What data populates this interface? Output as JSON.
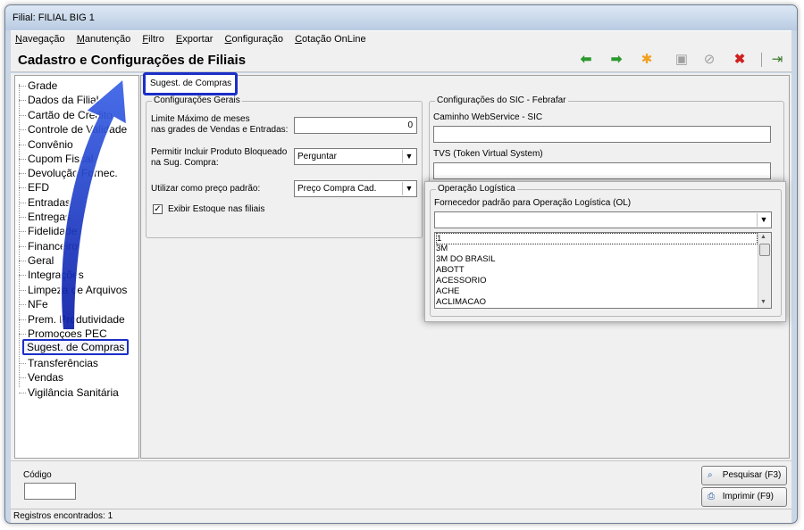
{
  "window": {
    "title": "Filial: FILIAL BIG 1"
  },
  "menu": [
    "Navegação",
    "Manutenção",
    "Filtro",
    "Exportar",
    "Configuração",
    "Cotação OnLine"
  ],
  "page_title": "Cadastro e Configurações de Filiais",
  "toolbar_icons": [
    "arrow-left-icon",
    "arrow-right-icon",
    "new-star-icon",
    "save-icon",
    "cancel-icon",
    "delete-icon",
    "exit-icon"
  ],
  "tree_items": [
    "Grade",
    "Dados da Filial",
    "Cartão de Crédito",
    "Controle de Validade",
    "Convênio",
    "Cupom Fiscal",
    "Devolução Fornec.",
    "EFD",
    "Entradas",
    "Entregas",
    "Fidelidade",
    "Financeiro",
    "Geral",
    "Integrações",
    "Limpeza de Arquivos",
    "NFe",
    "Prem. Produtividade",
    "Promoções PEC",
    "Sugest. de Compras",
    "Transferências",
    "Vendas",
    "Vigilância Sanitária"
  ],
  "active_tab": "Sugest. de Compras",
  "general": {
    "title": "Configurações Gerais",
    "months_label_1": "Limite Máximo de meses",
    "months_label_2": "nas grades de Vendas e Entradas:",
    "months_value": "0",
    "blocked_label_1": "Permitir Incluir Produto Bloqueado",
    "blocked_label_2": "na Sug. Compra:",
    "blocked_value": "Perguntar",
    "price_label": "Utilizar como preço padrão:",
    "price_value": "Preço Compra Cad.",
    "stock_label": "Exibir Estoque nas filiais",
    "stock_checked": true
  },
  "sic": {
    "title": "Configurações do SIC - Febrafar",
    "ws_label": "Caminho WebService - SIC",
    "ws_value": "",
    "tvs_label": "TVS (Token Virtual System)",
    "tvs_value": ""
  },
  "logistics": {
    "title": "Operação Logística",
    "supplier_label": "Fornecedor padrão para Operação Logística (OL)",
    "supplier_value": "",
    "options": [
      "1",
      "3M",
      "3M DO BRASIL",
      "ABOTT",
      "ACESSORIO",
      "ACHE",
      "ACLIMACAO"
    ]
  },
  "search": {
    "code_label": "Código",
    "code_value": ""
  },
  "buttons": {
    "search": "Pesquisar (F3)",
    "print": "Imprimir (F9)"
  },
  "status": "Registros encontrados: 1",
  "colors": {
    "highlight": "#1b2fc8"
  }
}
